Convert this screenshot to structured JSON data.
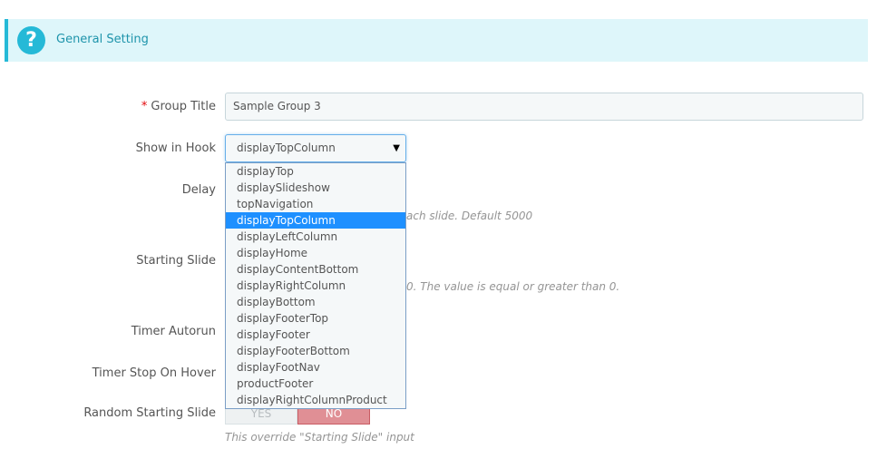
{
  "header": {
    "title": "General Setting",
    "help_icon": "?"
  },
  "form": {
    "group_title": {
      "required_mark": "*",
      "label": "Group Title",
      "value": "Sample Group 3"
    },
    "show_in_hook": {
      "label": "Show in Hook",
      "selected": "displayTopColumn",
      "options": [
        "displayTop",
        "displaySlideshow",
        "topNavigation",
        "displayTopColumn",
        "displayLeftColumn",
        "displayHome",
        "displayContentBottom",
        "displayRightColumn",
        "displayBottom",
        "displayFooterTop",
        "displayFooter",
        "displayFooterBottom",
        "displayFootNav",
        "productFooter",
        "displayRightColumnProduct"
      ]
    },
    "delay": {
      "label": "Delay",
      "help_partial": "ach slide. Default 5000"
    },
    "starting_slide": {
      "label": "Starting Slide",
      "help_partial": "0. The value is equal or greater than 0."
    },
    "timer_autorun": {
      "label": "Timer Autorun"
    },
    "timer_stop_on_hover": {
      "label": "Timer Stop On Hover"
    },
    "random_starting_slide": {
      "label": "Random Starting Slide",
      "yes_label": "YES",
      "no_label": "NO",
      "help": "This override \"Starting Slide\" input"
    }
  }
}
